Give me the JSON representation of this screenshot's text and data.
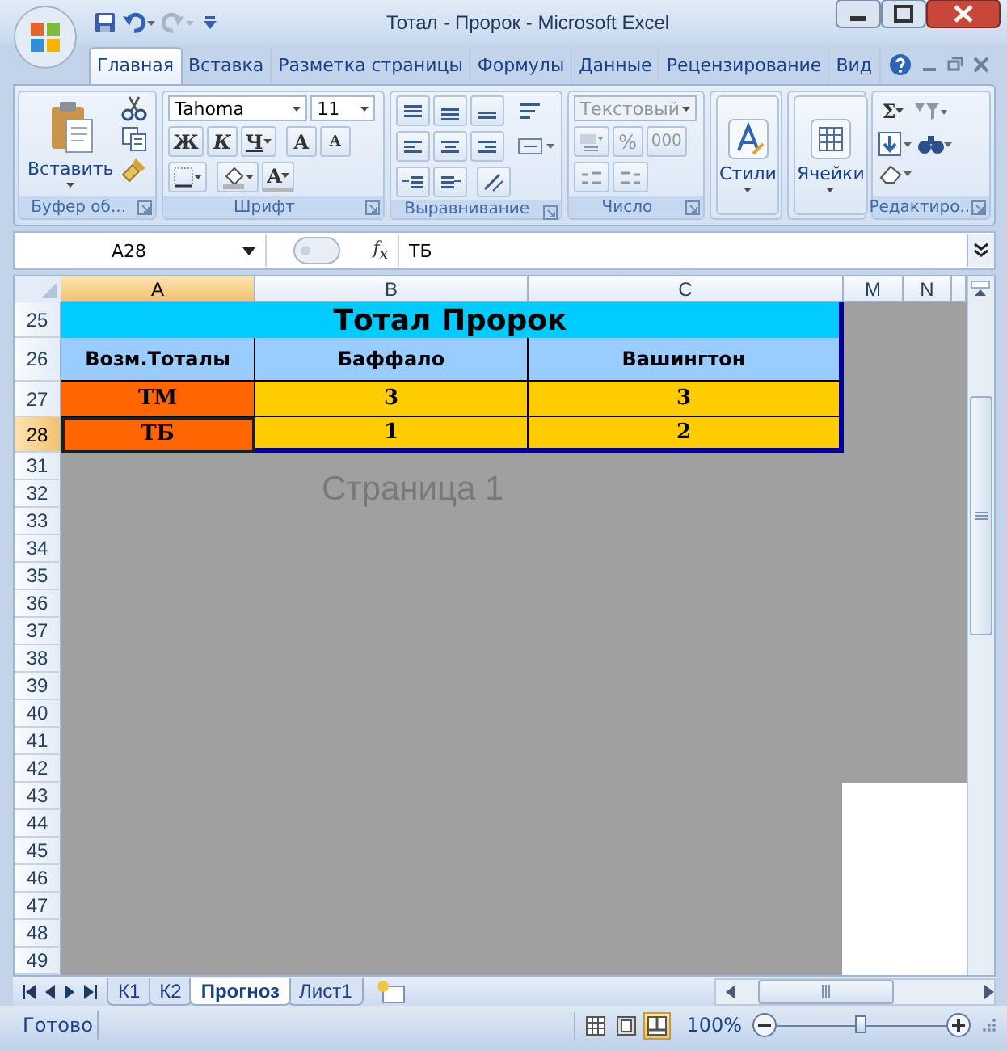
{
  "window": {
    "title": "Тотал - Пророк - Microsoft Excel"
  },
  "ribbon_tabs": [
    {
      "label": "Главная",
      "selected": true
    },
    {
      "label": "Вставка",
      "selected": false
    },
    {
      "label": "Разметка страницы",
      "selected": false
    },
    {
      "label": "Формулы",
      "selected": false
    },
    {
      "label": "Данные",
      "selected": false
    },
    {
      "label": "Рецензирование",
      "selected": false
    },
    {
      "label": "Вид",
      "selected": false
    }
  ],
  "ribbon": {
    "clipboard": {
      "label": "Буфер об...",
      "paste": "Вставить"
    },
    "font": {
      "label": "Шрифт",
      "name": "Tahoma",
      "size": "11",
      "bold": "Ж",
      "italic": "К",
      "underline": "Ч",
      "grow": "A",
      "shrink": "A",
      "text_color": "A"
    },
    "alignment": {
      "label": "Выравнивание"
    },
    "number": {
      "label": "Число",
      "format": "Текстовый",
      "format_disabled": true,
      "percent": "%",
      "thousands": "000"
    },
    "styles": {
      "button": "Стили"
    },
    "cells": {
      "button": "Ячейки"
    },
    "editing": {
      "label": "Редактиро...",
      "sum": "Σ"
    }
  },
  "formula_bar": {
    "name_box": "A28",
    "fx": "f$_{x}$",
    "formula": "ТБ"
  },
  "sheet": {
    "watermark": "Страница 1",
    "columns": [
      {
        "label": "A",
        "selected": true
      },
      {
        "label": "B",
        "selected": false
      },
      {
        "label": "C",
        "selected": false
      },
      {
        "label": "M",
        "selected": false
      },
      {
        "label": "N",
        "selected": false
      }
    ],
    "rows": [
      {
        "label": "25",
        "kind": "title",
        "selected": false,
        "cells": [
          {
            "text": "Тотал Пророк",
            "color": "#00ccff"
          }
        ]
      },
      {
        "label": "26",
        "kind": "header",
        "selected": false,
        "cells": [
          {
            "text": "Возм.Тоталы",
            "color": "#99ccff"
          },
          {
            "text": "Баффало",
            "color": "#99ccff"
          },
          {
            "text": "Вашингтон",
            "color": "#99ccff"
          }
        ]
      },
      {
        "label": "27",
        "kind": "data",
        "selected": false,
        "cells": [
          {
            "text": "ТМ",
            "color": "#ff6600",
            "selected": false
          },
          {
            "text": "3",
            "color": "#ffcc00",
            "selected": false
          },
          {
            "text": "3",
            "color": "#ffcc00",
            "selected": false
          }
        ]
      },
      {
        "label": "28",
        "kind": "data",
        "selected": true,
        "cells": [
          {
            "text": "ТБ",
            "color": "#ff6600",
            "selected": true
          },
          {
            "text": "1",
            "color": "#ffcc00",
            "selected": false
          },
          {
            "text": "2",
            "color": "#ffcc00",
            "selected": false
          }
        ]
      },
      {
        "label": "31",
        "selected": false
      },
      {
        "label": "32",
        "selected": false
      },
      {
        "label": "33",
        "selected": false
      },
      {
        "label": "34",
        "selected": false
      },
      {
        "label": "35",
        "selected": false
      },
      {
        "label": "36",
        "selected": false
      },
      {
        "label": "37",
        "selected": false
      },
      {
        "label": "38",
        "selected": false
      },
      {
        "label": "39",
        "selected": false
      },
      {
        "label": "40",
        "selected": false
      },
      {
        "label": "41",
        "selected": false
      },
      {
        "label": "42",
        "selected": false
      },
      {
        "label": "43",
        "selected": false
      },
      {
        "label": "44",
        "selected": false
      },
      {
        "label": "45",
        "selected": false
      },
      {
        "label": "46",
        "selected": false
      },
      {
        "label": "47",
        "selected": false
      },
      {
        "label": "48",
        "selected": false
      },
      {
        "label": "49",
        "selected": false
      }
    ]
  },
  "sheet_tabs": [
    {
      "label": "К1",
      "selected": false
    },
    {
      "label": "К2",
      "selected": false
    },
    {
      "label": "Прогноз",
      "selected": true
    },
    {
      "label": "Лист1",
      "selected": false
    }
  ],
  "status_bar": {
    "status": "Готово",
    "views": [
      {
        "selected": false
      },
      {
        "selected": false
      },
      {
        "selected": true
      }
    ],
    "zoom": "100%",
    "zoom_slider": {
      "level": 0.5
    }
  }
}
